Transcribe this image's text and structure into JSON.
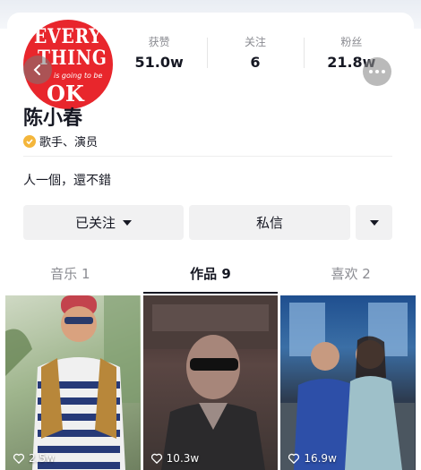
{
  "profile": {
    "avatar_text": {
      "line1": "EVERY",
      "line2": "THING",
      "line3": "is going to be",
      "line4": "OK"
    },
    "name": "陈小春",
    "verification": "歌手、演员",
    "bio": "人一個，還不錯"
  },
  "stats": [
    {
      "label": "获赞",
      "value": "51.0w"
    },
    {
      "label": "关注",
      "value": "6"
    },
    {
      "label": "粉丝",
      "value": "21.8w"
    }
  ],
  "actions": {
    "follow_label": "已关注",
    "message_label": "私信"
  },
  "tabs": [
    {
      "label": "音乐 1",
      "active": false
    },
    {
      "label": "作品 9",
      "active": true
    },
    {
      "label": "喜欢 2",
      "active": false
    }
  ],
  "videos": [
    {
      "likes": "2.5w"
    },
    {
      "likes": "10.3w"
    },
    {
      "likes": "16.9w"
    }
  ],
  "icons": {
    "back": "chevron-left-icon",
    "more": "more-dots-icon",
    "verified": "verified-badge-icon",
    "like": "heart-icon",
    "dropdown": "caret-down-icon"
  },
  "colors": {
    "verified_badge": "#f4b63b",
    "text_primary": "#161823",
    "text_secondary": "#8a8b91",
    "avatar_bg": "#e8262c"
  }
}
